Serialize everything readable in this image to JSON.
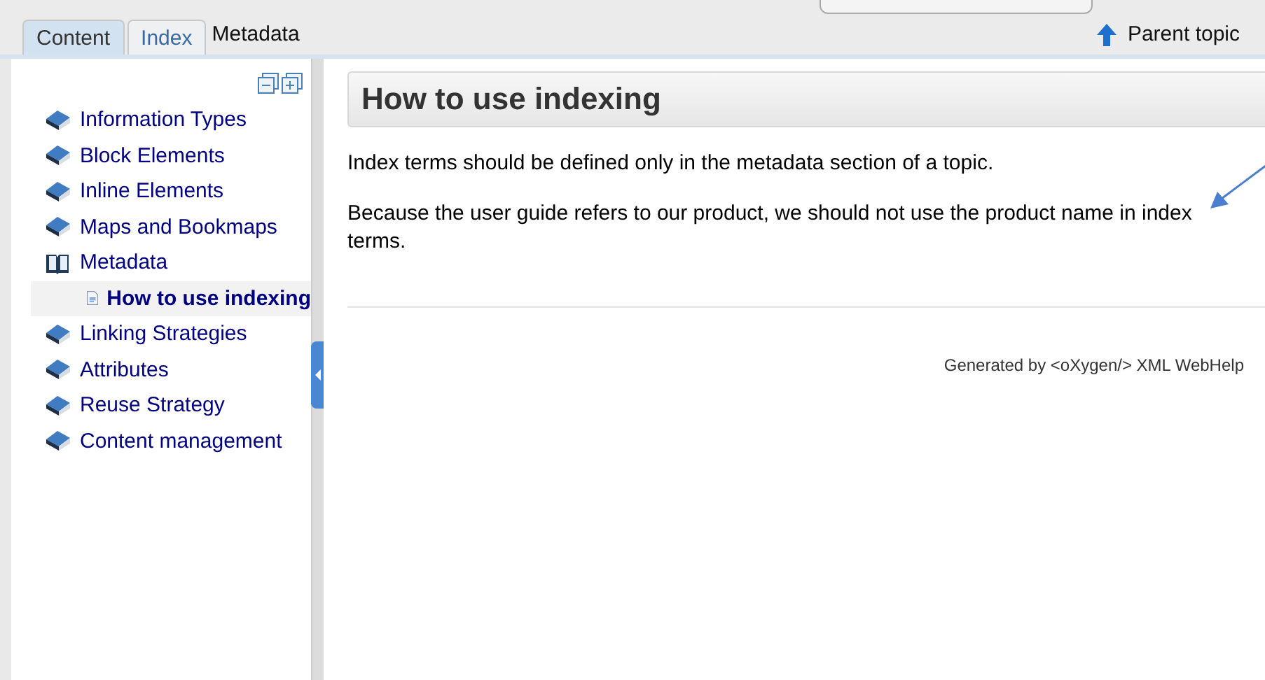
{
  "tabs": [
    {
      "label": "Content",
      "selected": true
    },
    {
      "label": "Index",
      "selected": false
    }
  ],
  "breadcrumb": "Metadata",
  "parent_topic": "Parent topic",
  "toc": [
    {
      "label": "Information Types",
      "kind": "book",
      "expanded": false,
      "selected": false
    },
    {
      "label": "Block Elements",
      "kind": "book",
      "expanded": false,
      "selected": false
    },
    {
      "label": "Inline Elements",
      "kind": "book",
      "expanded": false,
      "selected": false
    },
    {
      "label": "Maps and Bookmaps",
      "kind": "book",
      "expanded": false,
      "selected": false
    },
    {
      "label": "Metadata",
      "kind": "book",
      "expanded": true,
      "selected": false,
      "children": [
        {
          "label": "How to use indexing",
          "kind": "topic",
          "selected": true
        }
      ]
    },
    {
      "label": "Linking Strategies",
      "kind": "book",
      "expanded": false,
      "selected": false
    },
    {
      "label": "Attributes",
      "kind": "book",
      "expanded": false,
      "selected": false
    },
    {
      "label": "Reuse Strategy",
      "kind": "book",
      "expanded": false,
      "selected": false
    },
    {
      "label": "Content management",
      "kind": "book",
      "expanded": false,
      "selected": false
    }
  ],
  "topic": {
    "title": "How to use indexing",
    "paragraphs": [
      "Index terms should be defined only in the metadata section of a topic.",
      "Because the user guide refers to our product, we should not use the product name in index terms."
    ]
  },
  "footer": "Generated by <oXygen/> XML WebHelp"
}
